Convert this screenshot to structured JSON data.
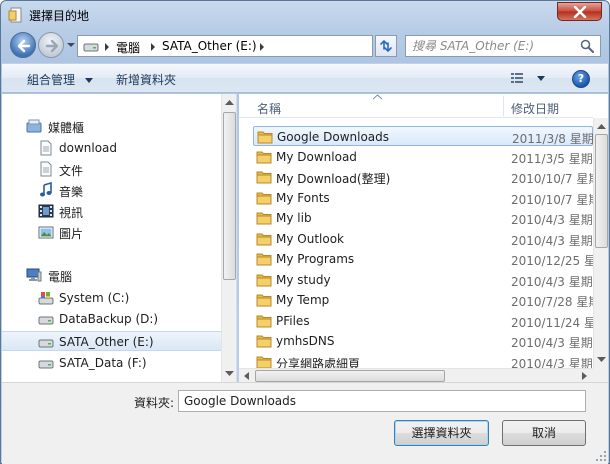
{
  "window": {
    "title": "選擇目的地"
  },
  "address": {
    "segments": [
      "電腦",
      "SATA_Other (E:)"
    ],
    "search_placeholder": "搜尋 SATA_Other (E:)"
  },
  "toolbar": {
    "organize_label": "組合管理",
    "new_folder_label": "新增資料夾"
  },
  "nav": {
    "favorites": {
      "label": "媒體櫃",
      "icon": "library-icon",
      "items": [
        {
          "label": "download",
          "icon": "document-icon"
        },
        {
          "label": "文件",
          "icon": "document-icon"
        },
        {
          "label": "音樂",
          "icon": "music-icon"
        },
        {
          "label": "視訊",
          "icon": "video-icon"
        },
        {
          "label": "圖片",
          "icon": "picture-icon"
        }
      ]
    },
    "computer": {
      "label": "電腦",
      "icon": "computer-icon",
      "items": [
        {
          "label": "System (C:)",
          "icon": "system-drive-icon"
        },
        {
          "label": "DataBackup (D:)",
          "icon": "drive-icon"
        },
        {
          "label": "SATA_Other (E:)",
          "icon": "drive-icon",
          "selected": true
        },
        {
          "label": "SATA_Data (F:)",
          "icon": "drive-icon"
        }
      ]
    }
  },
  "list": {
    "headers": {
      "name": "名稱",
      "date": "修改日期"
    },
    "rows": [
      {
        "name": "Google Downloads",
        "date": "2011/3/8 星期",
        "selected": true
      },
      {
        "name": "My Download",
        "date": "2011/3/5 星期"
      },
      {
        "name": "My Download(整理)",
        "date": "2010/10/7 星期"
      },
      {
        "name": "My Fonts",
        "date": "2010/10/7 星期"
      },
      {
        "name": "My lib",
        "date": "2010/4/3 星期"
      },
      {
        "name": "My Outlook",
        "date": "2010/4/3 星期"
      },
      {
        "name": "My Programs",
        "date": "2010/12/25 星"
      },
      {
        "name": "My study",
        "date": "2010/4/3 星期"
      },
      {
        "name": "My Temp",
        "date": "2010/7/28 星期"
      },
      {
        "name": "PFiles",
        "date": "2010/11/24 星"
      },
      {
        "name": "ymhsDNS",
        "date": "2010/4/3 星期"
      },
      {
        "name": "分享網路處細頁",
        "date": "2010/4/3 星期"
      }
    ]
  },
  "bottom": {
    "folder_label": "資料夾:",
    "folder_value": "Google Downloads",
    "select_label": "選擇資料夾",
    "cancel_label": "取消"
  },
  "colors": {
    "accent": "#3c7fb1",
    "selection": "#d9e9fb",
    "folder": "#e8b93c"
  }
}
